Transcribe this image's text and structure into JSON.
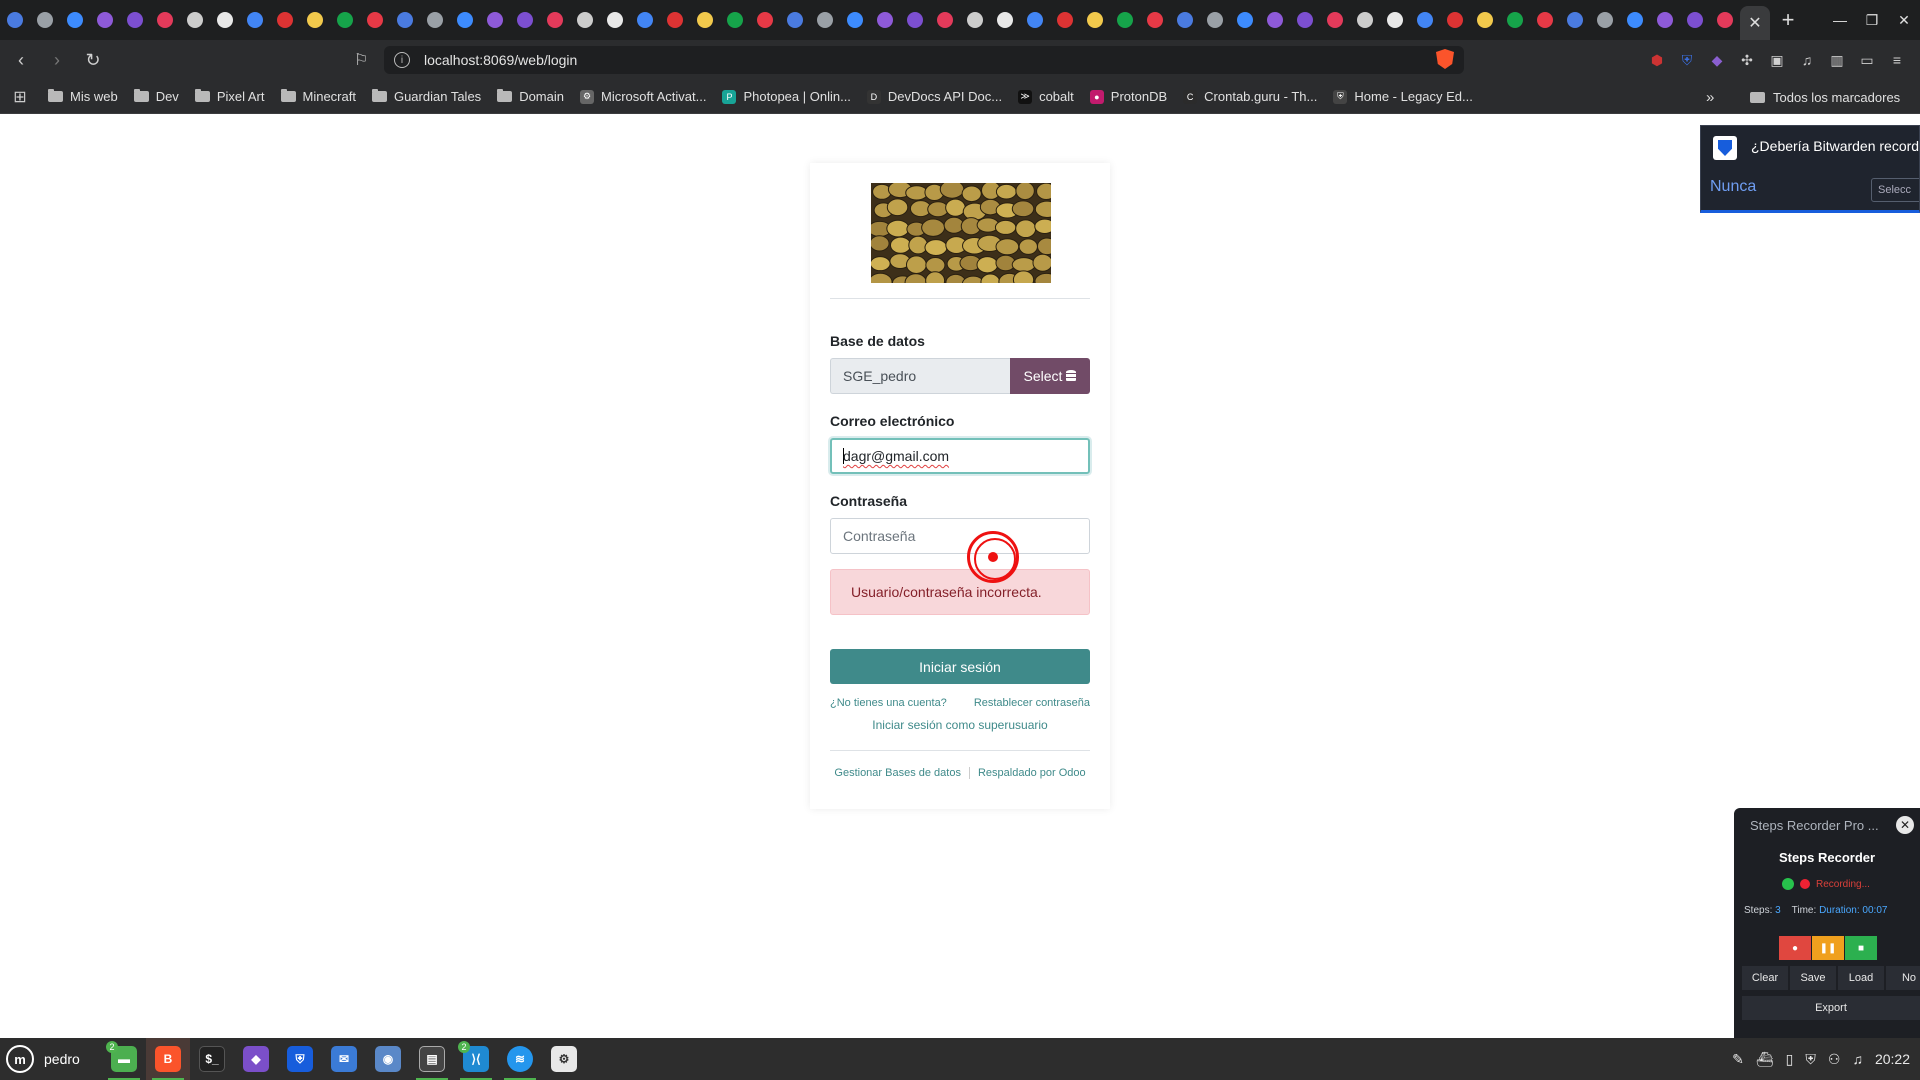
{
  "browser": {
    "url": "localhost:8069/web/login",
    "tab_count_favicons": 58,
    "bookmarks": [
      {
        "label": "Mis web",
        "kind": "folder"
      },
      {
        "label": "Dev",
        "kind": "folder"
      },
      {
        "label": "Pixel Art",
        "kind": "folder"
      },
      {
        "label": "Minecraft",
        "kind": "folder"
      },
      {
        "label": "Guardian Tales",
        "kind": "folder"
      },
      {
        "label": "Domain",
        "kind": "folder"
      },
      {
        "label": "Microsoft Activat...",
        "kind": "gear"
      },
      {
        "label": "Photopea | Onlin...",
        "kind": "photopea"
      },
      {
        "label": "DevDocs API Doc...",
        "kind": "devdocs"
      },
      {
        "label": "cobalt",
        "kind": "cobalt"
      },
      {
        "label": "ProtonDB",
        "kind": "protondb"
      },
      {
        "label": "Crontab.guru - Th...",
        "kind": "crontab"
      },
      {
        "label": "Home - Legacy Ed...",
        "kind": "shield"
      }
    ],
    "all_bookmarks": "Todos los marcadores"
  },
  "login": {
    "db_label": "Base de datos",
    "db_value": "SGE_pedro",
    "db_select": "Select",
    "email_label": "Correo electrónico",
    "email_value": "dagr@gmail.com",
    "password_label": "Contraseña",
    "password_placeholder": "Contraseña",
    "error": "Usuario/contraseña incorrecta.",
    "submit": "Iniciar sesión",
    "no_account": "¿No tienes una cuenta?",
    "reset": "Restablecer contraseña",
    "superuser": "Iniciar sesión como superusuario",
    "manage_db": "Gestionar Bases de datos",
    "powered": "Respaldado por Odoo"
  },
  "bitwarden": {
    "question": "¿Debería Bitwarden recordar",
    "never": "Nunca",
    "select": "Selecc"
  },
  "steps_recorder": {
    "window_title": "Steps Recorder Pro ...",
    "heading": "Steps Recorder",
    "status": "Recording...",
    "steps_label": "Steps:",
    "steps_value": "3",
    "time_label": "Time:",
    "duration": "Duration: 00:07",
    "buttons": [
      "Clear",
      "Save",
      "Load",
      "No"
    ],
    "export": "Export"
  },
  "taskbar": {
    "user": "pedro",
    "clock": "20:22",
    "files_badge": "2",
    "vscode_badge": "2"
  },
  "colors": {
    "odoo_primary": "#714b67",
    "odoo_teal": "#3f8a8a",
    "alert_bg": "#f8d7da"
  }
}
